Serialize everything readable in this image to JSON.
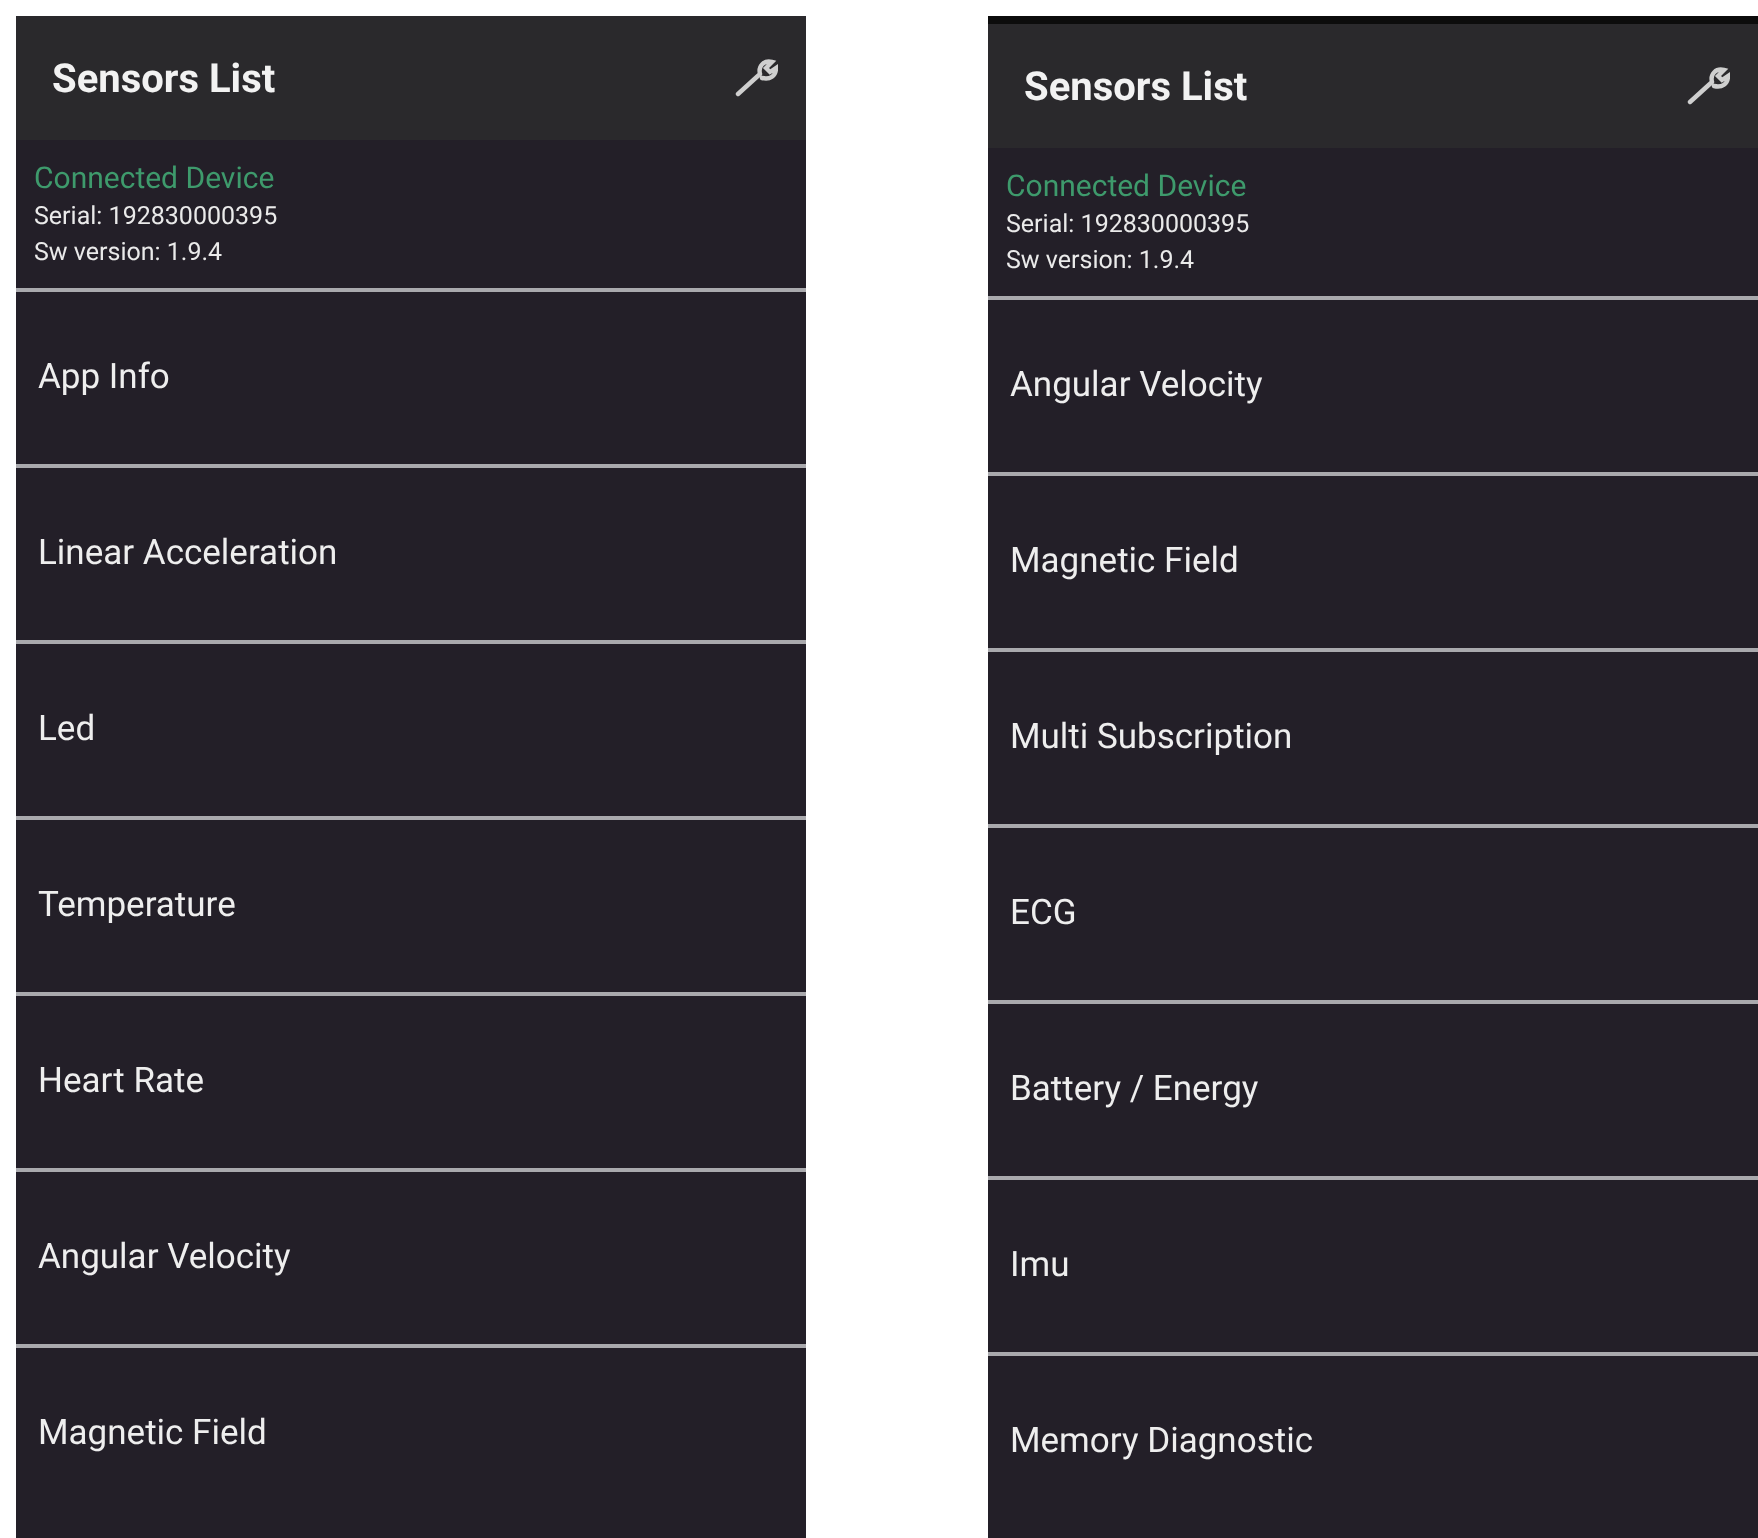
{
  "screens": [
    {
      "title": "Sensors List",
      "device": {
        "heading": "Connected Device",
        "serial": "Serial: 192830000395",
        "version": "Sw version: 1.9.4"
      },
      "items": [
        "App Info",
        "Linear Acceleration",
        "Led",
        "Temperature",
        "Heart Rate",
        "Angular Velocity",
        "Magnetic Field"
      ]
    },
    {
      "title": "Sensors List",
      "device": {
        "heading": "Connected Device",
        "serial": "Serial: 192830000395",
        "version": "Sw version: 1.9.4"
      },
      "items": [
        "Angular Velocity",
        "Magnetic Field",
        "Multi Subscription",
        "ECG",
        "Battery / Energy",
        "Imu",
        "Memory Diagnostic"
      ]
    }
  ]
}
